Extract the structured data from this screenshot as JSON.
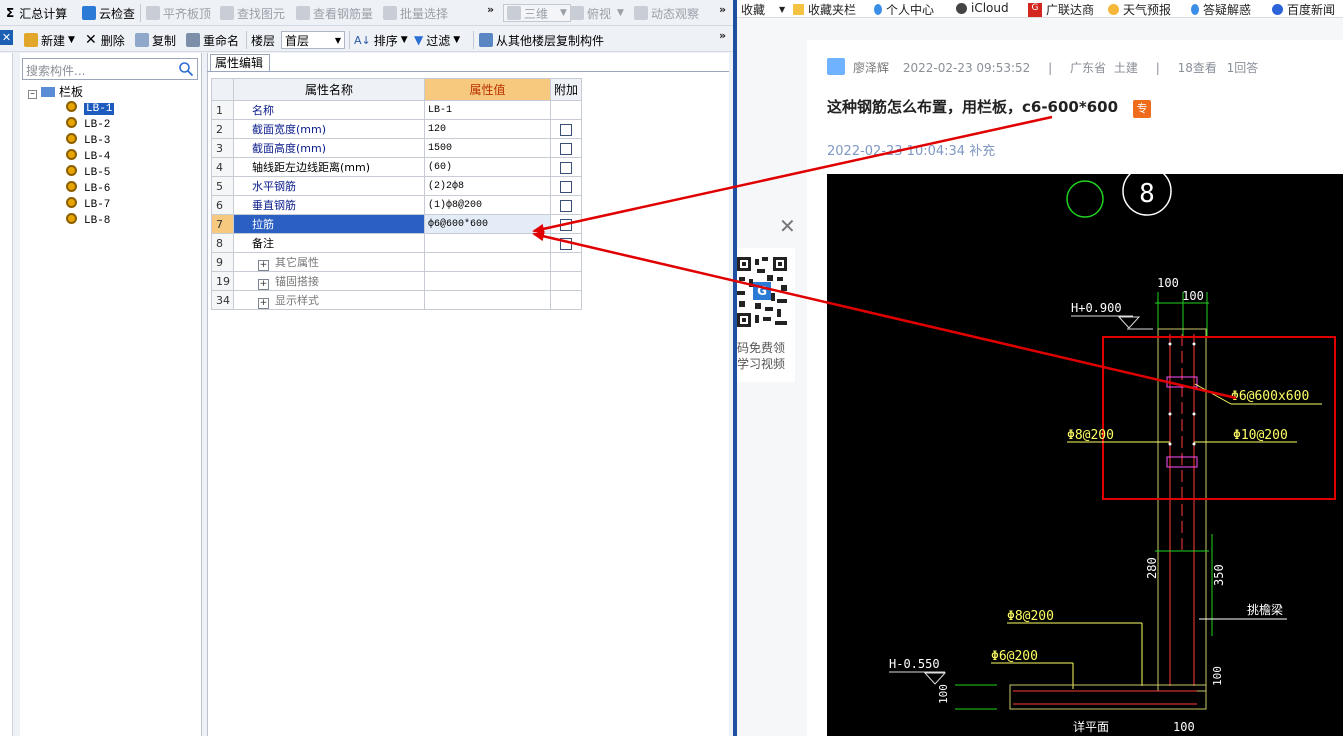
{
  "toolbar1": {
    "summary": "汇总计算",
    "cloud_check": "云检查",
    "align_slab": "平齐板顶",
    "find_element": "查找图元",
    "view_rebar": "查看钢筋量",
    "batch_select": "批量选择",
    "view3d": "三维",
    "top_view": "俯视",
    "dyn_view": "动态观察"
  },
  "toolbar2": {
    "new": "新建",
    "delete": "删除",
    "copy": "复制",
    "rename": "重命名",
    "floor_label": "楼层",
    "floor_value": "首层",
    "sort": "排序",
    "filter": "过滤",
    "copy_from_floor": "从其他楼层复制构件"
  },
  "left_panel": {
    "search_placeholder": "搜索构件...",
    "root": "栏板",
    "items": [
      "LB-1",
      "LB-2",
      "LB-3",
      "LB-4",
      "LB-5",
      "LB-6",
      "LB-7",
      "LB-8"
    ]
  },
  "prop_panel": {
    "tab": "属性编辑",
    "col_name": "属性名称",
    "col_value": "属性值",
    "col_extra": "附加",
    "rows": [
      {
        "no": "1",
        "name": "名称",
        "value": "LB-1",
        "check": false
      },
      {
        "no": "2",
        "name": "截面宽度(mm)",
        "value": "120",
        "check": true
      },
      {
        "no": "3",
        "name": "截面高度(mm)",
        "value": "1500",
        "check": true
      },
      {
        "no": "4",
        "name": "轴线距左边线距离(mm)",
        "value": "(60)",
        "check": true
      },
      {
        "no": "5",
        "name": "水平钢筋",
        "value": "(2)2ф8",
        "check": true
      },
      {
        "no": "6",
        "name": "垂直钢筋",
        "value": "(1)ф8@200",
        "check": true
      },
      {
        "no": "7",
        "name": "拉筋",
        "value": "ф6@600*600",
        "check": true
      },
      {
        "no": "8",
        "name": "备注",
        "value": "",
        "check": true
      },
      {
        "no": "9",
        "name": "其它属性",
        "value": "",
        "check": false
      },
      {
        "no": "19",
        "name": "锚固搭接",
        "value": "",
        "check": false
      },
      {
        "no": "34",
        "name": "显示样式",
        "value": "",
        "check": false
      }
    ]
  },
  "bookmarks": [
    "收藏",
    "收藏夹栏",
    "个人中心",
    "iCloud",
    "广联达商",
    "天气预报",
    "答疑解惑",
    "百度新闻"
  ],
  "question": {
    "author": "廖泽辉",
    "date": "2022-02-23 09:53:52",
    "region": "广东省",
    "category": "土建",
    "views": "18查看",
    "answers": "1回答",
    "title": "这种钢筋怎么布置，用栏板，c6-600*600",
    "badge": "专",
    "supplement": "2022-02-23 10:04:34 补充"
  },
  "qr_text": [
    "码免费领",
    "学习视频"
  ],
  "cad_labels": {
    "circle_num": "8",
    "dim_100a": "100",
    "dim_100b": "100",
    "elev_top": "H+0.900",
    "tie": "Φ6@600x600",
    "left_bar": "Φ8@200",
    "right_bar": "Φ10@200",
    "dim_280": "280",
    "dim_350": "350",
    "beam_label": "挑檐梁",
    "bar8": "Φ8@200",
    "bar6": "Φ6@200",
    "elev_bot": "H-0.550",
    "dim_100c": "100",
    "dim_100d": "100",
    "dim_100e": "100",
    "plan_label": "详平面"
  },
  "colors": {
    "accent_blue": "#1e5bbf",
    "header_orange": "#f7c97e",
    "arrow_red": "#e00000",
    "cad_bg": "#000000"
  }
}
